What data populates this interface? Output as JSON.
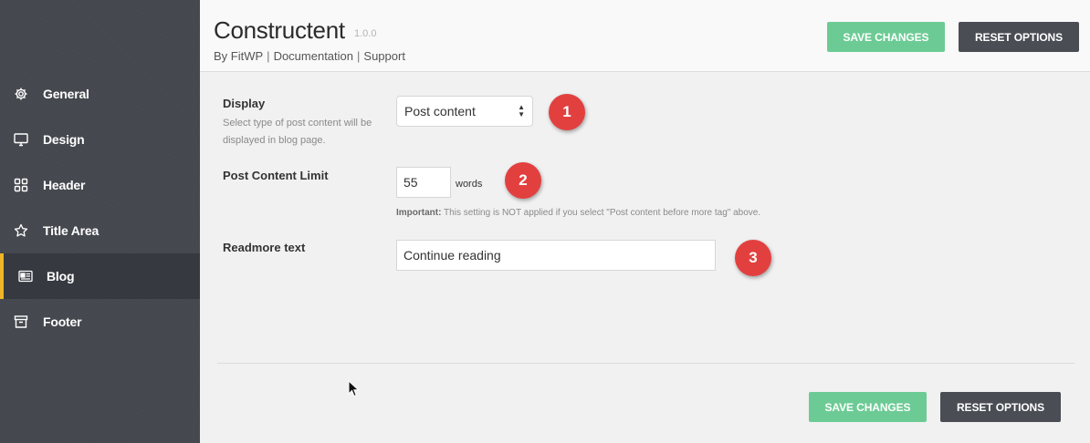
{
  "sidebar": {
    "items": [
      {
        "label": "General",
        "icon": "gear-icon",
        "active": false
      },
      {
        "label": "Design",
        "icon": "monitor-icon",
        "active": false
      },
      {
        "label": "Header",
        "icon": "grid-icon",
        "active": false
      },
      {
        "label": "Title Area",
        "icon": "star-icon",
        "active": false
      },
      {
        "label": "Blog",
        "icon": "blog-icon",
        "active": true
      },
      {
        "label": "Footer",
        "icon": "archive-icon",
        "active": false
      }
    ]
  },
  "header": {
    "title": "Constructent",
    "version": "1.0.0",
    "by": "By FitWP",
    "separator": "|",
    "documentation": "Documentation",
    "support": "Support",
    "save_label": "SAVE CHANGES",
    "reset_label": "RESET OPTIONS"
  },
  "form": {
    "display": {
      "label": "Display",
      "description": "Select type of post content will be displayed in blog page.",
      "value": "Post content",
      "badge": "1"
    },
    "limit": {
      "label": "Post Content Limit",
      "value": "55",
      "unit": "words",
      "note_strong": "Important:",
      "note_text": " This setting is NOT applied if you select \"Post content before more tag\" above.",
      "badge": "2"
    },
    "readmore": {
      "label": "Readmore text",
      "value": "Continue reading",
      "badge": "3"
    }
  },
  "footer": {
    "save_label": "SAVE CHANGES",
    "reset_label": "RESET OPTIONS"
  },
  "colors": {
    "sidebar_bg": "#44474d",
    "active_accent": "#f0b429",
    "save_button": "#6ccb94",
    "reset_button": "#4a4d54",
    "badge": "#e2403f"
  }
}
